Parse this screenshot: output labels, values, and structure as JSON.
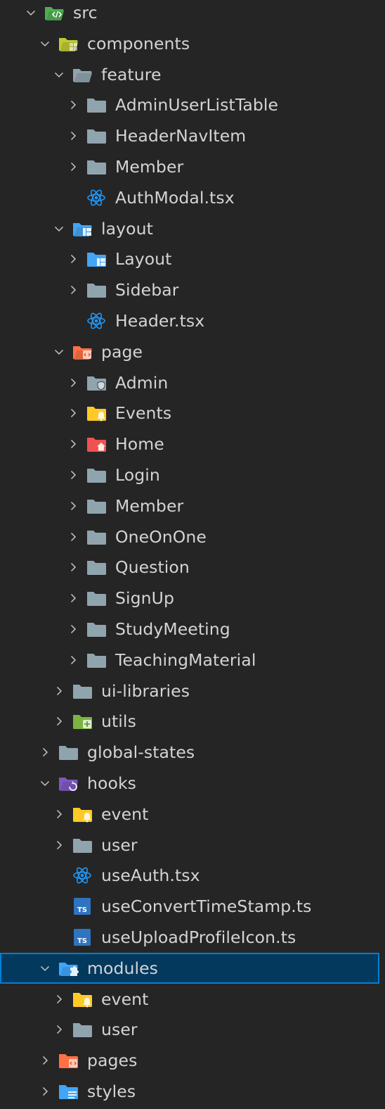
{
  "explorer": {
    "items": [
      {
        "label": "src",
        "depth": 0,
        "expanded": true,
        "icon": "src-folder-open-icon"
      },
      {
        "label": "components",
        "depth": 1,
        "expanded": true,
        "icon": "components-folder-open-icon"
      },
      {
        "label": "feature",
        "depth": 2,
        "expanded": true,
        "icon": "folder-open-icon"
      },
      {
        "label": "AdminUserListTable",
        "depth": 3,
        "expanded": false,
        "icon": "folder-icon"
      },
      {
        "label": "HeaderNavItem",
        "depth": 3,
        "expanded": false,
        "icon": "folder-icon"
      },
      {
        "label": "Member",
        "depth": 3,
        "expanded": false,
        "icon": "folder-icon"
      },
      {
        "label": "AuthModal.tsx",
        "depth": 3,
        "file": true,
        "icon": "react-icon"
      },
      {
        "label": "layout",
        "depth": 2,
        "expanded": true,
        "icon": "layout-folder-open-icon"
      },
      {
        "label": "Layout",
        "depth": 3,
        "expanded": false,
        "icon": "layout-folder-icon"
      },
      {
        "label": "Sidebar",
        "depth": 3,
        "expanded": false,
        "icon": "folder-icon"
      },
      {
        "label": "Header.tsx",
        "depth": 3,
        "file": true,
        "icon": "react-icon"
      },
      {
        "label": "page",
        "depth": 2,
        "expanded": true,
        "icon": "page-folder-open-icon"
      },
      {
        "label": "Admin",
        "depth": 3,
        "expanded": false,
        "icon": "admin-folder-icon"
      },
      {
        "label": "Events",
        "depth": 3,
        "expanded": false,
        "icon": "event-folder-icon"
      },
      {
        "label": "Home",
        "depth": 3,
        "expanded": false,
        "icon": "home-folder-icon"
      },
      {
        "label": "Login",
        "depth": 3,
        "expanded": false,
        "icon": "folder-icon"
      },
      {
        "label": "Member",
        "depth": 3,
        "expanded": false,
        "icon": "folder-icon"
      },
      {
        "label": "OneOnOne",
        "depth": 3,
        "expanded": false,
        "icon": "folder-icon"
      },
      {
        "label": "Question",
        "depth": 3,
        "expanded": false,
        "icon": "folder-icon"
      },
      {
        "label": "SignUp",
        "depth": 3,
        "expanded": false,
        "icon": "folder-icon"
      },
      {
        "label": "StudyMeeting",
        "depth": 3,
        "expanded": false,
        "icon": "folder-icon"
      },
      {
        "label": "TeachingMaterial",
        "depth": 3,
        "expanded": false,
        "icon": "folder-icon"
      },
      {
        "label": "ui-libraries",
        "depth": 2,
        "expanded": false,
        "icon": "folder-icon"
      },
      {
        "label": "utils",
        "depth": 2,
        "expanded": false,
        "icon": "utils-folder-icon"
      },
      {
        "label": "global-states",
        "depth": 1,
        "expanded": false,
        "icon": "folder-icon"
      },
      {
        "label": "hooks",
        "depth": 1,
        "expanded": true,
        "icon": "hooks-folder-open-icon"
      },
      {
        "label": "event",
        "depth": 2,
        "expanded": false,
        "icon": "event-folder-icon"
      },
      {
        "label": "user",
        "depth": 2,
        "expanded": false,
        "icon": "folder-icon"
      },
      {
        "label": "useAuth.tsx",
        "depth": 2,
        "file": true,
        "icon": "react-icon"
      },
      {
        "label": "useConvertTimeStamp.ts",
        "depth": 2,
        "file": true,
        "icon": "typescript-icon"
      },
      {
        "label": "useUploadProfileIcon.ts",
        "depth": 2,
        "file": true,
        "icon": "typescript-icon"
      },
      {
        "label": "modules",
        "depth": 1,
        "expanded": true,
        "icon": "modules-folder-open-icon",
        "selected": true
      },
      {
        "label": "event",
        "depth": 2,
        "expanded": false,
        "icon": "event-folder-icon"
      },
      {
        "label": "user",
        "depth": 2,
        "expanded": false,
        "icon": "folder-icon"
      },
      {
        "label": "pages",
        "depth": 1,
        "expanded": false,
        "icon": "page-folder-icon"
      },
      {
        "label": "styles",
        "depth": 1,
        "expanded": false,
        "icon": "styles-folder-icon"
      }
    ]
  },
  "colors": {
    "background": "#252526",
    "text": "#d4d4d4",
    "chevron": "#c5c5c5",
    "selection_bg": "#04395e",
    "selection_border": "#007fd4",
    "folder_gray": "#90a4ae",
    "react_blue": "#2196f3",
    "typescript_blue": "#2f74c0",
    "src_green": "#4caf50",
    "components_yellow": "#c0ca33",
    "layout_blue": "#42a5f5",
    "page_orange": "#ff7043",
    "event_yellow": "#ffca28",
    "home_red": "#ef5350",
    "utils_green": "#7cb342",
    "hooks_purple": "#7e57c2",
    "styles_blue": "#42a5f5"
  }
}
